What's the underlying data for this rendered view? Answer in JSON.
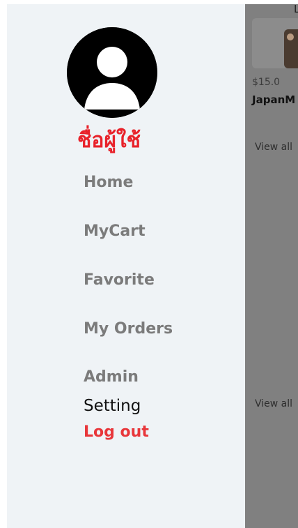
{
  "drawer": {
    "avatar_icon": "user-avatar-icon",
    "username": "ชื่อผู้ใช้",
    "menu": {
      "home": "Home",
      "mycart": "MyCart",
      "favorite": "Favorite",
      "my_orders": "My Orders",
      "admin": "Admin",
      "setting": "Setting",
      "logout": "Log out"
    }
  },
  "background": {
    "top_letter": "L",
    "price": "$15.0",
    "product_name": "JapanM",
    "view_all_1": "View all",
    "view_all_2": "View all"
  },
  "colors": {
    "drawer_bg": "#eff3f6",
    "accent_red": "#e8222a",
    "menu_gray": "#7b7b7b",
    "overlay_gray": "#808080"
  }
}
